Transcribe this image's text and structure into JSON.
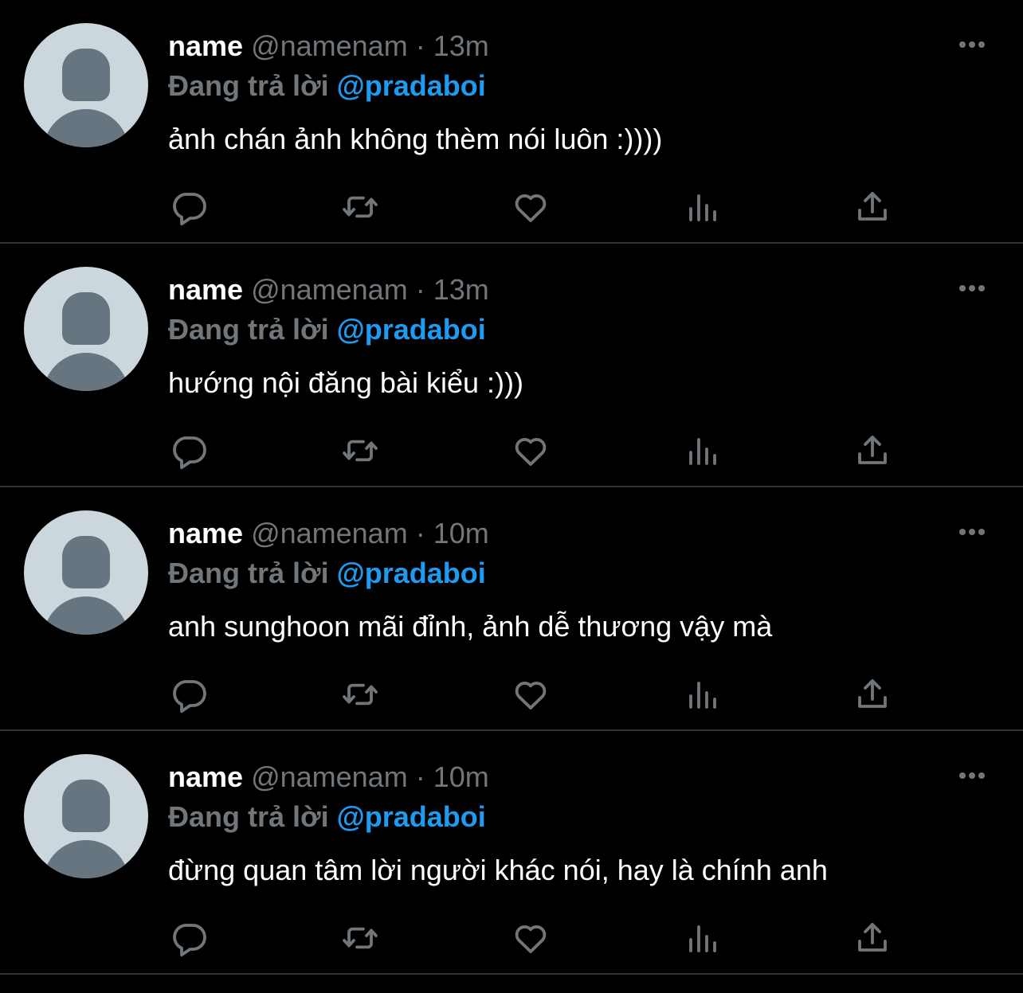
{
  "tweets": [
    {
      "name": "name",
      "handle": "@namenam",
      "separator": "·",
      "time": "13m",
      "reply_label": "Đang trả lời",
      "reply_to": "@pradaboi",
      "text": "ảnh chán ảnh không thèm nói luôn :))))"
    },
    {
      "name": "name",
      "handle": "@namenam",
      "separator": "·",
      "time": "13m",
      "reply_label": "Đang trả lời",
      "reply_to": "@pradaboi",
      "text": "hướng nội đăng bài kiểu :)))"
    },
    {
      "name": "name",
      "handle": "@namenam",
      "separator": "·",
      "time": "10m",
      "reply_label": "Đang trả lời",
      "reply_to": "@pradaboi",
      "text": "anh sunghoon mãi đỉnh, ảnh dễ thương vậy mà"
    },
    {
      "name": "name",
      "handle": "@namenam",
      "separator": "·",
      "time": "10m",
      "reply_label": "Đang trả lời",
      "reply_to": "@pradaboi",
      "text": "đừng quan tâm lời người khác nói, hay là chính anh"
    }
  ],
  "icons": {
    "avatar": "default-avatar-icon",
    "more": "more-horizontal-icon",
    "reply": "reply-icon",
    "retweet": "retweet-icon",
    "like": "heart-icon",
    "views": "views-icon",
    "share": "share-icon"
  },
  "colors": {
    "background": "#000000",
    "name": "#ffffff",
    "muted": "#71767b",
    "mention": "#1d9bf0",
    "divider": "#2f3336",
    "avatar_bg": "#ccd6dd",
    "avatar_fg": "#66757f"
  }
}
